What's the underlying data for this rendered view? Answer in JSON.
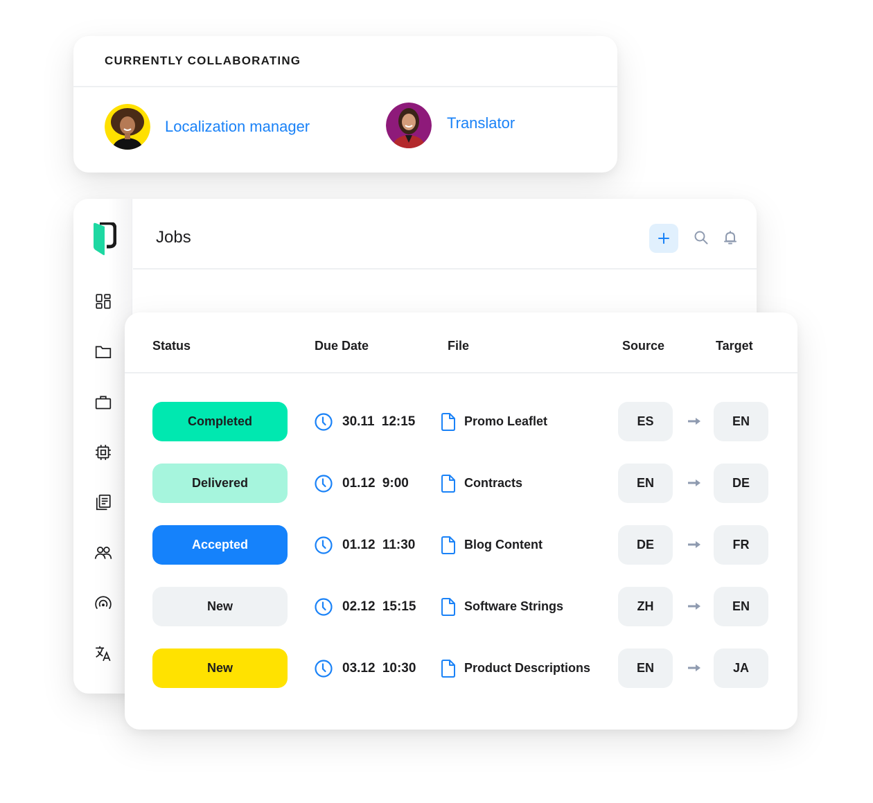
{
  "collaboration": {
    "title": "CURRENTLY COLLABORATING",
    "people": [
      {
        "role": "Localization manager",
        "avatar_bg": "#ffe000"
      },
      {
        "role": "Translator",
        "avatar_bg": "#8e1a7a"
      }
    ]
  },
  "app": {
    "page_title": "Jobs",
    "header_actions": {
      "add": "plus-icon",
      "search": "search-icon",
      "notifications": "bell-icon"
    },
    "sidebar": [
      "dashboard-icon",
      "folder-icon",
      "briefcase-icon",
      "chip-icon",
      "documents-icon",
      "users-icon",
      "broadcast-icon",
      "translate-icon"
    ]
  },
  "table": {
    "columns": [
      "Status",
      "Due Date",
      "File",
      "Source",
      "Target"
    ],
    "rows": [
      {
        "status": "Completed",
        "status_bg": "#00e8b0",
        "status_fg": "#1d1d1f",
        "due": "30.11 12:15",
        "file": "Promo Leaflet",
        "source": "ES",
        "target": "EN"
      },
      {
        "status": "Delivered",
        "status_bg": "#a6f5dd",
        "status_fg": "#1d1d1f",
        "due": "01.12 9:00",
        "file": "Contracts",
        "source": "EN",
        "target": "DE"
      },
      {
        "status": "Accepted",
        "status_bg": "#1582fb",
        "status_fg": "#ffffff",
        "due": "01.12 11:30",
        "file": "Blog Content",
        "source": "DE",
        "target": "FR"
      },
      {
        "status": "New",
        "status_bg": "#eff2f4",
        "status_fg": "#1d1d1f",
        "due": "02.12 15:15",
        "file": "Software Strings",
        "source": "ZH",
        "target": "EN"
      },
      {
        "status": "New",
        "status_bg": "#ffe200",
        "status_fg": "#1d1d1f",
        "due": "03.12 10:30",
        "file": "Product Descriptions",
        "source": "EN",
        "target": "JA"
      }
    ]
  },
  "colors": {
    "accent": "#1a82f7",
    "brand_green": "#1ed8a2",
    "icon_gray": "#8f9bb0"
  }
}
